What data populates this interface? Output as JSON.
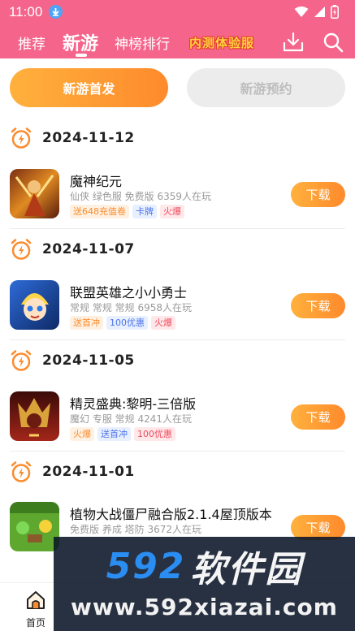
{
  "status_bar": {
    "time": "11:00"
  },
  "nav": {
    "tabs": [
      {
        "label": "推荐"
      },
      {
        "label": "新游"
      },
      {
        "label": "神榜排行"
      }
    ],
    "promo": "内测体验服"
  },
  "segments": {
    "active": "新游首发",
    "inactive": "新游预约"
  },
  "sections": [
    {
      "date": "2024-11-12",
      "game": {
        "title": "魔神纪元",
        "meta": "仙侠 绿色服 免费版  6359人在玩",
        "tags": [
          {
            "text": "送648充值卷",
            "color": "orange"
          },
          {
            "text": "卡牌",
            "color": "blue"
          },
          {
            "text": "火爆",
            "color": "red"
          }
        ],
        "button": "下载"
      }
    },
    {
      "date": "2024-11-07",
      "game": {
        "title": "联盟英雄之小小勇士",
        "meta": "常规 常规 常规  6958人在玩",
        "tags": [
          {
            "text": "送首冲",
            "color": "orange"
          },
          {
            "text": "100优惠",
            "color": "blue"
          },
          {
            "text": "火爆",
            "color": "red"
          }
        ],
        "button": "下载"
      }
    },
    {
      "date": "2024-11-05",
      "game": {
        "title": "精灵盛典:黎明-三倍版",
        "meta": "魔幻 专服 常规  4241人在玩",
        "tags": [
          {
            "text": "火爆",
            "color": "orange"
          },
          {
            "text": "送首冲",
            "color": "blue"
          },
          {
            "text": "100优惠",
            "color": "red"
          }
        ],
        "button": "下载"
      }
    },
    {
      "date": "2024-11-01",
      "game": {
        "title": "植物大战僵尸融合版2.1.4屋顶版本",
        "meta": "免费版 养成 塔防  3672人在玩",
        "tags": [],
        "button": "下载"
      }
    }
  ],
  "bottom_nav": {
    "home_label": "首页"
  },
  "watermark": {
    "brand_digits": "592",
    "brand_cn": "软件园",
    "url": "www.592xiazai.com"
  },
  "colors": {
    "header_pink": "#f5658b",
    "accent_orange": "#fe8a2c",
    "promo_yellow": "#ffd23f"
  }
}
